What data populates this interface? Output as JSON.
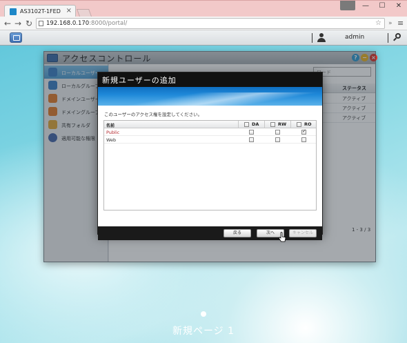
{
  "browser": {
    "tab_title": "AS3102T-1FED",
    "tab_close": "×",
    "url_host": "192.168.0.170",
    "url_rest": ":8000/portal/",
    "win_minimize": "—",
    "win_maximize": "☐",
    "win_close": "✕",
    "back": "←",
    "forward": "→",
    "reload": "↻",
    "star": "☆",
    "extensions": "»",
    "menu": "≡"
  },
  "nas_bar": {
    "username": "admin"
  },
  "access_control": {
    "title": "アクセスコントロール",
    "sidebar": [
      {
        "label": "ローカルユーザー",
        "icon": "local-user-icon",
        "color": "#3a7fc4",
        "active": true
      },
      {
        "label": "ローカルグループ",
        "icon": "local-group-icon",
        "color": "#3a7fc4",
        "active": false
      },
      {
        "label": "ドメインユーザー",
        "icon": "domain-user-icon",
        "color": "#e07a2a",
        "active": false
      },
      {
        "label": "ドメイングループ",
        "icon": "domain-group-icon",
        "color": "#e07a2a",
        "active": false
      },
      {
        "label": "共有フォルダ",
        "icon": "shared-folder-icon",
        "color": "#e0a83a",
        "active": false
      },
      {
        "label": "適用可能な権限",
        "icon": "permission-icon",
        "color": "#4466aa",
        "active": false
      }
    ],
    "search_placeholder": "ワード",
    "status_header": "ステータス",
    "statuses": [
      "アクティブ",
      "アクティブ",
      "アクティブ"
    ],
    "pager": "1 - 3 / 3"
  },
  "modal": {
    "title": "新規ユーザーの追加",
    "description": "このユーザーのアクセス権を設定してください。",
    "columns": {
      "name": "名前",
      "deny": "DA",
      "readwrite": "RW",
      "readonly": "RO"
    },
    "rows": [
      {
        "name": "Public",
        "name_color": "#b3262c",
        "deny": false,
        "readwrite": false,
        "readonly": true
      },
      {
        "name": "Web",
        "name_color": "#333333",
        "deny": false,
        "readwrite": false,
        "readonly": false
      }
    ],
    "buttons": {
      "back": "戻る",
      "next": "次へ",
      "cancel": "キャンセル"
    }
  },
  "desktop": {
    "page_label": "新規ページ 1"
  },
  "colors": {
    "accent": "#1e88d8",
    "desktop_bg": "#7fd3e3"
  }
}
